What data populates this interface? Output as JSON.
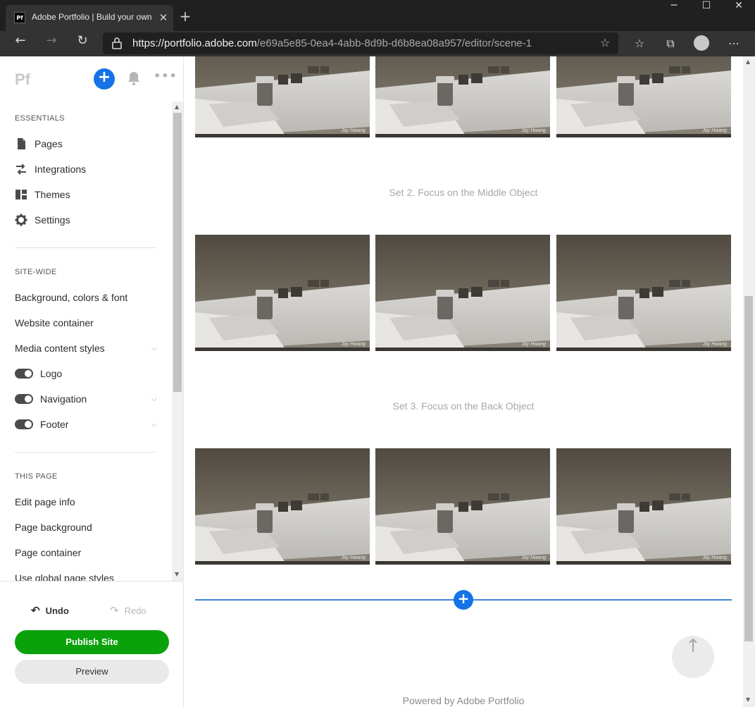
{
  "browser": {
    "tab_title": "Adobe Portfolio | Build your own",
    "favicon_text": "Pf",
    "url_host": "https://portfolio.adobe.com",
    "url_path": "/e69a5e85-0ea4-4abb-8d9b-d6b8ea08a957/editor/scene-1"
  },
  "sidebar": {
    "logo": "Pf",
    "essentials_label": "ESSENTIALS",
    "essentials": [
      {
        "label": "Pages",
        "icon": "page-icon"
      },
      {
        "label": "Integrations",
        "icon": "swap-arrows-icon"
      },
      {
        "label": "Themes",
        "icon": "layout-grid-icon"
      },
      {
        "label": "Settings",
        "icon": "gear-icon"
      }
    ],
    "sitewide_label": "SITE-WIDE",
    "sitewide": [
      {
        "label": "Background, colors & font"
      },
      {
        "label": "Website container"
      },
      {
        "label": "Media content styles",
        "expandable": true
      }
    ],
    "toggles": [
      {
        "label": "Logo",
        "on": true
      },
      {
        "label": "Navigation",
        "on": true,
        "expandable": true
      },
      {
        "label": "Footer",
        "on": true,
        "expandable": true
      }
    ],
    "thispage_label": "THIS PAGE",
    "thispage": [
      {
        "label": "Edit page info"
      },
      {
        "label": "Page background"
      },
      {
        "label": "Page container"
      },
      {
        "label": "Use global page styles"
      }
    ],
    "undo_label": "Undo",
    "redo_label": "Redo",
    "publish_label": "Publish Site",
    "preview_label": "Preview"
  },
  "content": {
    "captions": [
      "Set 2. Focus on the Middle Object",
      "Set 3. Focus on the Back Object"
    ],
    "watermark": "Jay Hwang",
    "footer": "Powered by Adobe Portfolio"
  },
  "colors": {
    "accent_blue": "#1473e6",
    "publish_green": "#0ba10b"
  }
}
